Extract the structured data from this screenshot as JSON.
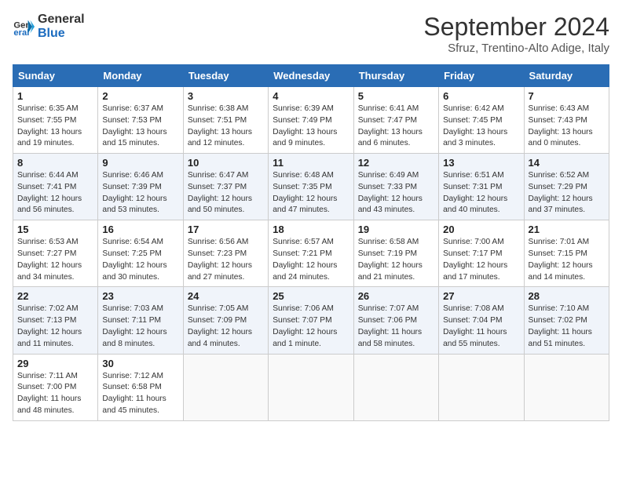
{
  "logo": {
    "line1": "General",
    "line2": "Blue"
  },
  "title": "September 2024",
  "subtitle": "Sfruz, Trentino-Alto Adige, Italy",
  "weekdays": [
    "Sunday",
    "Monday",
    "Tuesday",
    "Wednesday",
    "Thursday",
    "Friday",
    "Saturday"
  ],
  "weeks": [
    [
      {
        "day": 1,
        "sunrise": "6:35 AM",
        "sunset": "7:55 PM",
        "daylight": "13 hours and 19 minutes."
      },
      {
        "day": 2,
        "sunrise": "6:37 AM",
        "sunset": "7:53 PM",
        "daylight": "13 hours and 15 minutes."
      },
      {
        "day": 3,
        "sunrise": "6:38 AM",
        "sunset": "7:51 PM",
        "daylight": "13 hours and 12 minutes."
      },
      {
        "day": 4,
        "sunrise": "6:39 AM",
        "sunset": "7:49 PM",
        "daylight": "13 hours and 9 minutes."
      },
      {
        "day": 5,
        "sunrise": "6:41 AM",
        "sunset": "7:47 PM",
        "daylight": "13 hours and 6 minutes."
      },
      {
        "day": 6,
        "sunrise": "6:42 AM",
        "sunset": "7:45 PM",
        "daylight": "13 hours and 3 minutes."
      },
      {
        "day": 7,
        "sunrise": "6:43 AM",
        "sunset": "7:43 PM",
        "daylight": "13 hours and 0 minutes."
      }
    ],
    [
      {
        "day": 8,
        "sunrise": "6:44 AM",
        "sunset": "7:41 PM",
        "daylight": "12 hours and 56 minutes."
      },
      {
        "day": 9,
        "sunrise": "6:46 AM",
        "sunset": "7:39 PM",
        "daylight": "12 hours and 53 minutes."
      },
      {
        "day": 10,
        "sunrise": "6:47 AM",
        "sunset": "7:37 PM",
        "daylight": "12 hours and 50 minutes."
      },
      {
        "day": 11,
        "sunrise": "6:48 AM",
        "sunset": "7:35 PM",
        "daylight": "12 hours and 47 minutes."
      },
      {
        "day": 12,
        "sunrise": "6:49 AM",
        "sunset": "7:33 PM",
        "daylight": "12 hours and 43 minutes."
      },
      {
        "day": 13,
        "sunrise": "6:51 AM",
        "sunset": "7:31 PM",
        "daylight": "12 hours and 40 minutes."
      },
      {
        "day": 14,
        "sunrise": "6:52 AM",
        "sunset": "7:29 PM",
        "daylight": "12 hours and 37 minutes."
      }
    ],
    [
      {
        "day": 15,
        "sunrise": "6:53 AM",
        "sunset": "7:27 PM",
        "daylight": "12 hours and 34 minutes."
      },
      {
        "day": 16,
        "sunrise": "6:54 AM",
        "sunset": "7:25 PM",
        "daylight": "12 hours and 30 minutes."
      },
      {
        "day": 17,
        "sunrise": "6:56 AM",
        "sunset": "7:23 PM",
        "daylight": "12 hours and 27 minutes."
      },
      {
        "day": 18,
        "sunrise": "6:57 AM",
        "sunset": "7:21 PM",
        "daylight": "12 hours and 24 minutes."
      },
      {
        "day": 19,
        "sunrise": "6:58 AM",
        "sunset": "7:19 PM",
        "daylight": "12 hours and 21 minutes."
      },
      {
        "day": 20,
        "sunrise": "7:00 AM",
        "sunset": "7:17 PM",
        "daylight": "12 hours and 17 minutes."
      },
      {
        "day": 21,
        "sunrise": "7:01 AM",
        "sunset": "7:15 PM",
        "daylight": "12 hours and 14 minutes."
      }
    ],
    [
      {
        "day": 22,
        "sunrise": "7:02 AM",
        "sunset": "7:13 PM",
        "daylight": "12 hours and 11 minutes."
      },
      {
        "day": 23,
        "sunrise": "7:03 AM",
        "sunset": "7:11 PM",
        "daylight": "12 hours and 8 minutes."
      },
      {
        "day": 24,
        "sunrise": "7:05 AM",
        "sunset": "7:09 PM",
        "daylight": "12 hours and 4 minutes."
      },
      {
        "day": 25,
        "sunrise": "7:06 AM",
        "sunset": "7:07 PM",
        "daylight": "12 hours and 1 minute."
      },
      {
        "day": 26,
        "sunrise": "7:07 AM",
        "sunset": "7:06 PM",
        "daylight": "11 hours and 58 minutes."
      },
      {
        "day": 27,
        "sunrise": "7:08 AM",
        "sunset": "7:04 PM",
        "daylight": "11 hours and 55 minutes."
      },
      {
        "day": 28,
        "sunrise": "7:10 AM",
        "sunset": "7:02 PM",
        "daylight": "11 hours and 51 minutes."
      }
    ],
    [
      {
        "day": 29,
        "sunrise": "7:11 AM",
        "sunset": "7:00 PM",
        "daylight": "11 hours and 48 minutes."
      },
      {
        "day": 30,
        "sunrise": "7:12 AM",
        "sunset": "6:58 PM",
        "daylight": "11 hours and 45 minutes."
      },
      null,
      null,
      null,
      null,
      null
    ]
  ]
}
